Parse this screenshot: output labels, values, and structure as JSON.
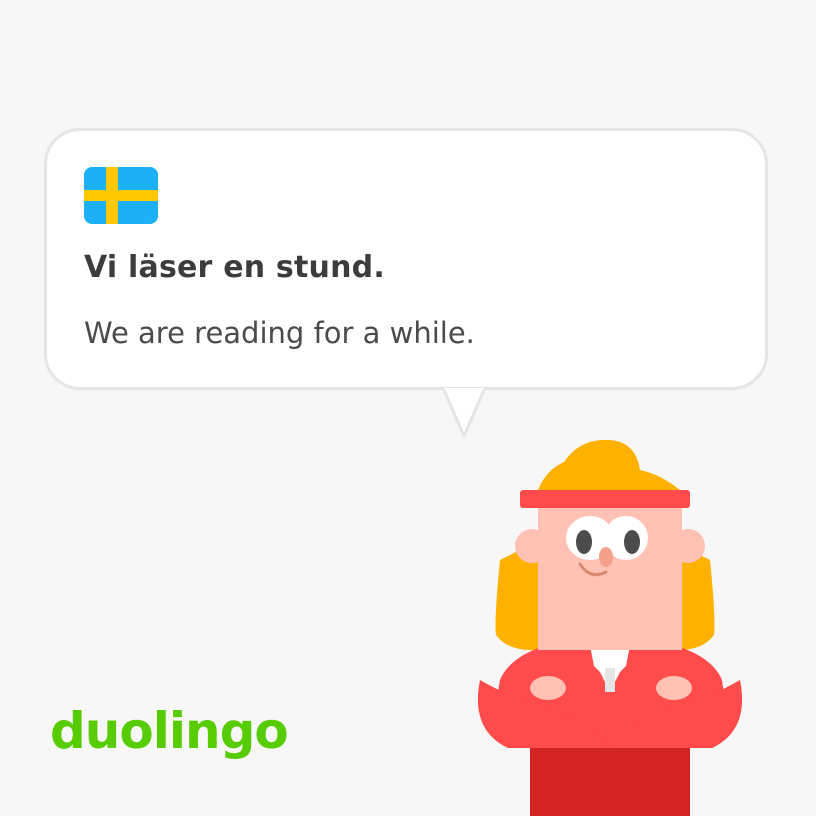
{
  "card": {
    "sentence": "Vi läser en stund.",
    "translation": "We are reading for a while."
  },
  "flag": {
    "icon": "sweden-flag-icon",
    "blue": "#1cb0f6",
    "yellow": "#ffc800"
  },
  "brand": {
    "logo_text": "duolingo",
    "color": "#58cc02"
  },
  "character": {
    "icon": "lin-character-icon"
  }
}
